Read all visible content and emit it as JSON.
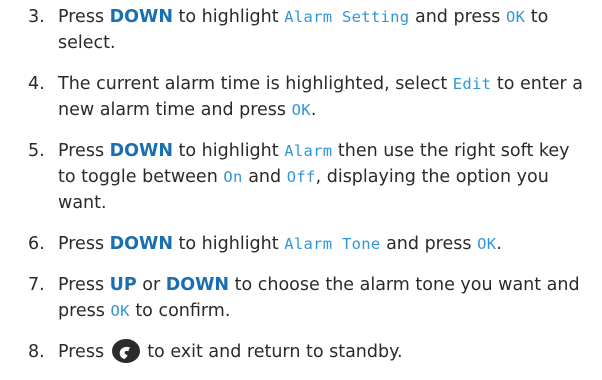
{
  "steps": [
    {
      "number": "3.",
      "t1": "Press ",
      "k1": "DOWN",
      "t2": " to highlight ",
      "s1": "Alarm Setting",
      "t3": " and press ",
      "s2": "OK",
      "t4": " to select."
    },
    {
      "number": "4.",
      "t1": "The current alarm time is highlighted, select ",
      "s1": "Edit",
      "t2": " to enter a new alarm time and press ",
      "s2": "OK",
      "t3": "."
    },
    {
      "number": "5.",
      "t1": "Press ",
      "k1": "DOWN",
      "t2": " to highlight ",
      "s1": "Alarm",
      "t3": " then use the right soft key to toggle between ",
      "s2": "On",
      "t4": " and ",
      "s3": "Off",
      "t5": ", displaying the option you want."
    },
    {
      "number": "6.",
      "t1": "Press ",
      "k1": "DOWN",
      "t2": " to highlight ",
      "s1": "Alarm Tone",
      "t3": " and press ",
      "s2": "OK",
      "t4": "."
    },
    {
      "number": "7.",
      "t1": "Press ",
      "k1": "UP",
      "t2": " or ",
      "k2": "DOWN",
      "t3": " to choose the alarm tone you want and press ",
      "s1": "OK",
      "t4": " to confirm."
    },
    {
      "number": "8.",
      "t1": "Press ",
      "icon": "end-call-key-icon",
      "t2": " to exit and return to standby."
    }
  ],
  "colors": {
    "key_text": "#1a6fb0",
    "screen_text": "#2f97d8",
    "body_text": "#2a2a2a"
  }
}
